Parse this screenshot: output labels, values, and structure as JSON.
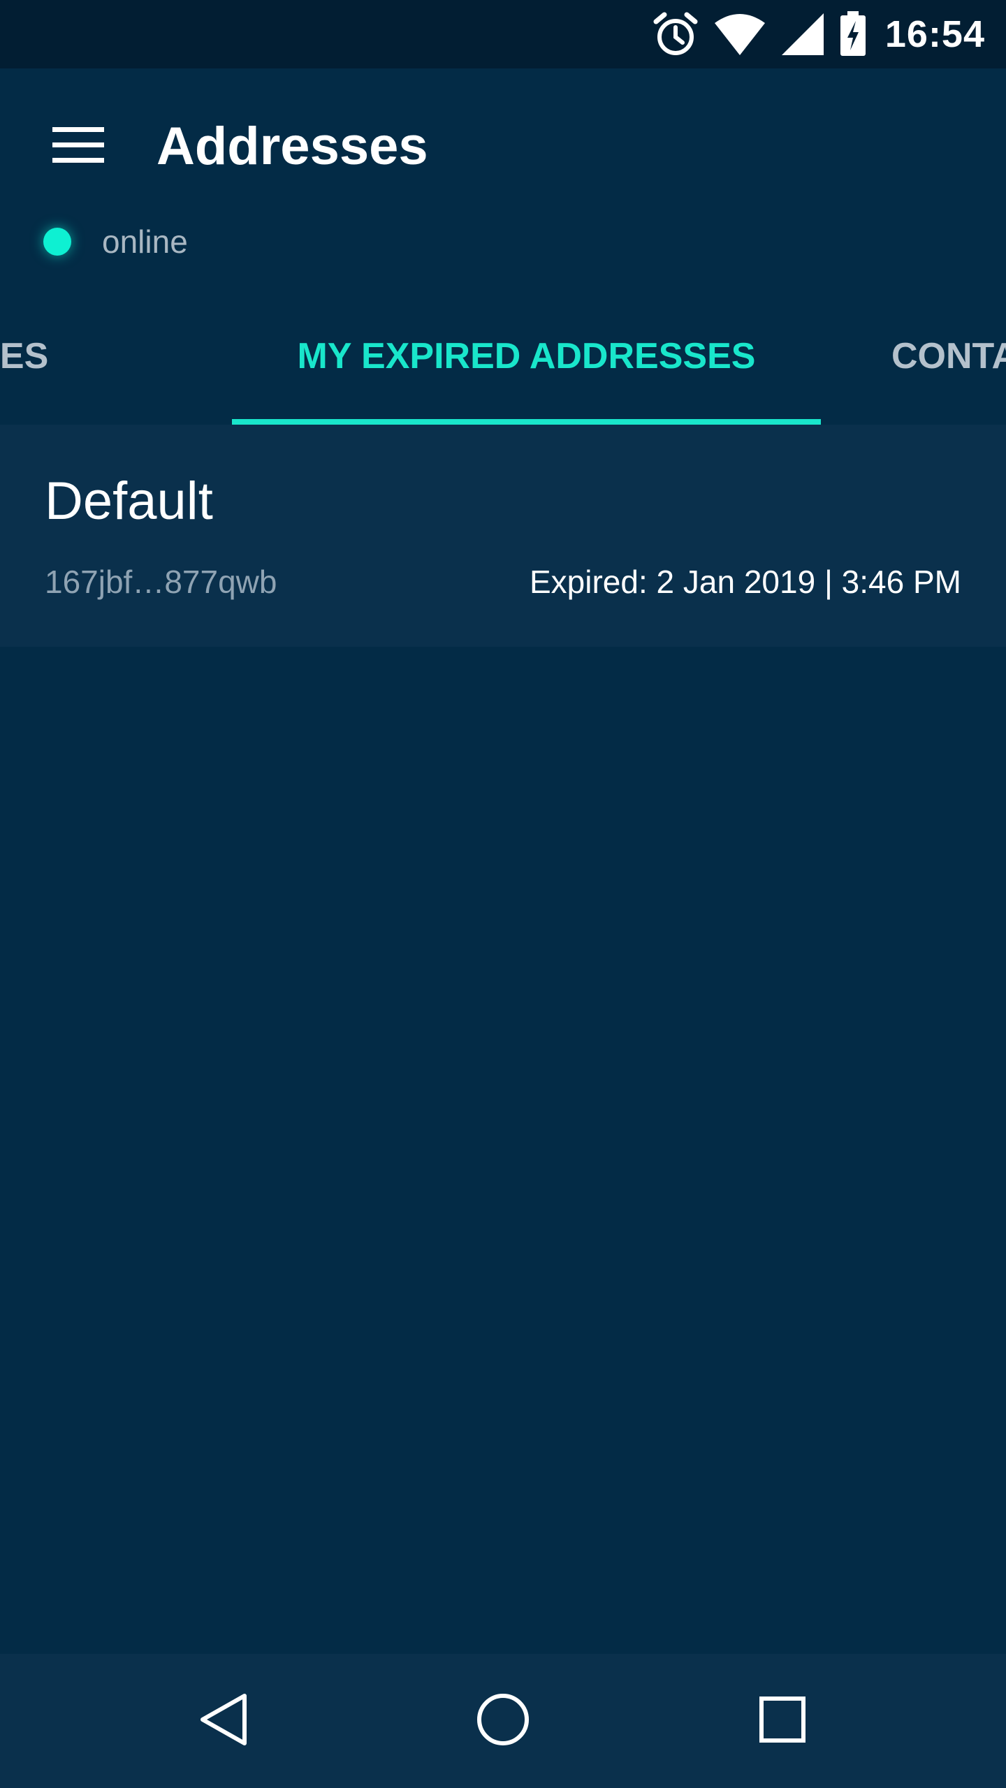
{
  "status_bar": {
    "time": "16:54",
    "icons": [
      "alarm-icon",
      "wifi-icon",
      "cell-signal-icon",
      "battery-charging-icon"
    ]
  },
  "app_bar": {
    "title": "Addresses",
    "menu_icon": "hamburger-menu-icon",
    "connection_status": "online",
    "connection_color": "#0ef0d2"
  },
  "tabs": [
    {
      "label": "MY ACTIVE ADDRESSES",
      "visible_text": "DRESSES",
      "selected": false
    },
    {
      "label": "MY EXPIRED ADDRESSES",
      "visible_text": "MY EXPIRED ADDRESSES",
      "selected": true
    },
    {
      "label": "CONTACTS",
      "visible_text": "CONTA",
      "selected": false
    }
  ],
  "addresses": [
    {
      "name": "Default",
      "id": "167jbf…877qwb",
      "expiry": "Expired: 2 Jan 2019  |  3:46 PM"
    }
  ],
  "nav_bar": {
    "buttons": [
      "back-icon",
      "home-icon",
      "recent-apps-icon"
    ]
  },
  "colors": {
    "background": "#032b46",
    "status_bar": "#021e33",
    "accent": "#19e6cb",
    "list_item": "#0a304c"
  }
}
